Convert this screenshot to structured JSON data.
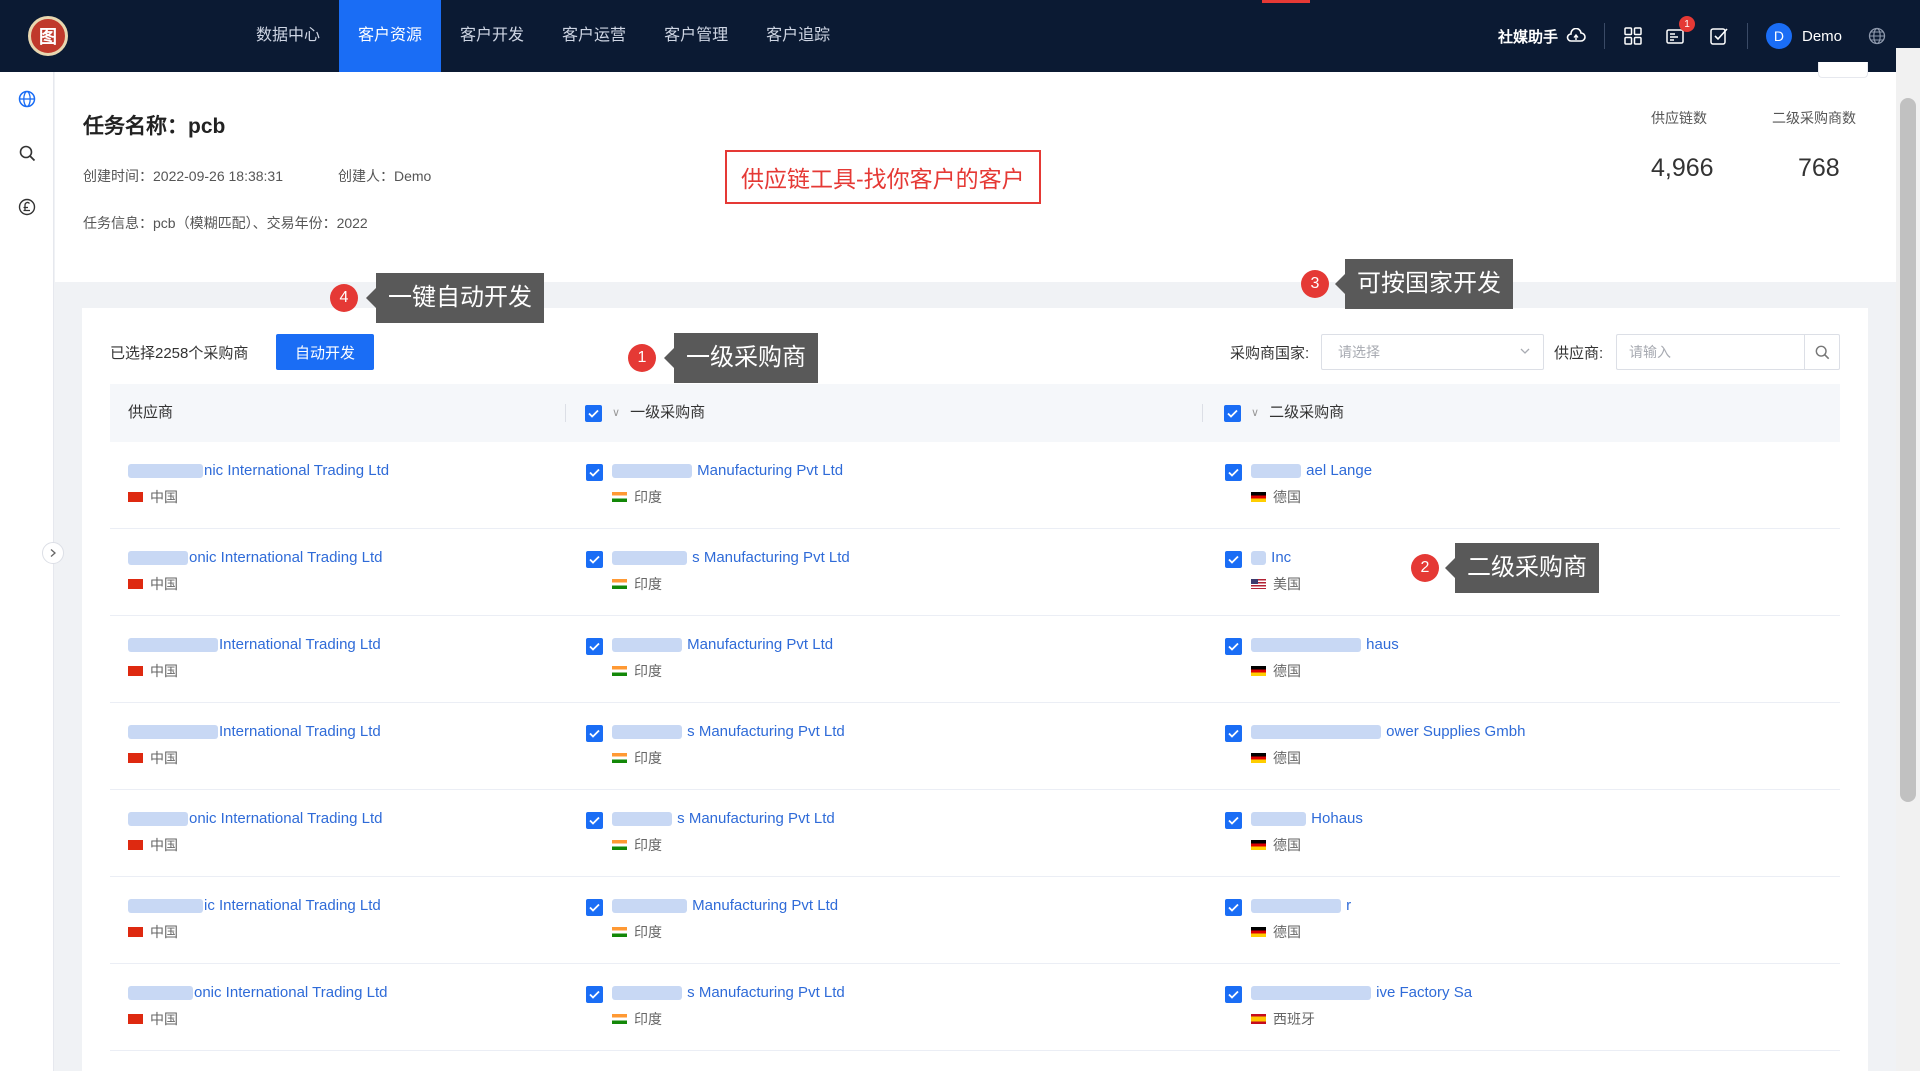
{
  "nav": {
    "logo": "图",
    "items": [
      "数据中心",
      "客户资源",
      "客户开发",
      "客户运营",
      "客户管理",
      "客户追踪"
    ],
    "active_index": 1
  },
  "topright": {
    "assistant": "社媒助手",
    "notification_count": "1",
    "user_initial": "D",
    "user_name": "Demo"
  },
  "task": {
    "title": "任务名称：pcb",
    "created_time": "创建时间：2022-09-26 18:38:31",
    "creator": "创建人：Demo",
    "info": "任务信息：pcb（模糊匹配）、交易年份：2022"
  },
  "promo_banner": "供应链工具-找你客户的客户",
  "stats": {
    "supply_chain_label": "供应链数",
    "supply_chain_value": "4,966",
    "second_buyer_label": "二级采购商数",
    "second_buyer_value": "768"
  },
  "toolbar": {
    "selected_text": "已选择2258个采购商",
    "auto_button": "自动开发",
    "country_label": "采购商国家:",
    "country_placeholder": "请选择",
    "supplier_label": "供应商:",
    "supplier_placeholder": "请输入"
  },
  "table": {
    "headers": [
      "供应商",
      "一级采购商",
      "二级采购商"
    ],
    "rows": [
      {
        "supplier": "nic International Trading Ltd",
        "supplier_country": "中国",
        "buyer1": "Manufacturing Pvt Ltd",
        "buyer1_country": "印度",
        "buyer2": "ael Lange",
        "buyer2_country": "德国",
        "buyer2_flag": "de"
      },
      {
        "supplier": "onic International Trading Ltd",
        "supplier_country": "中国",
        "buyer1": "s Manufacturing Pvt Ltd",
        "buyer1_country": "印度",
        "buyer2": "Inc",
        "buyer2_country": "美国",
        "buyer2_flag": "us"
      },
      {
        "supplier": "International Trading Ltd",
        "supplier_country": "中国",
        "buyer1": "Manufacturing Pvt Ltd",
        "buyer1_country": "印度",
        "buyer2": "haus",
        "buyer2_country": "德国",
        "buyer2_flag": "de"
      },
      {
        "supplier": "International Trading Ltd",
        "supplier_country": "中国",
        "buyer1": "s Manufacturing Pvt Ltd",
        "buyer1_country": "印度",
        "buyer2": "ower Supplies Gmbh",
        "buyer2_country": "德国",
        "buyer2_flag": "de"
      },
      {
        "supplier": "onic International Trading Ltd",
        "supplier_country": "中国",
        "buyer1": "s Manufacturing Pvt Ltd",
        "buyer1_country": "印度",
        "buyer2": "Hohaus",
        "buyer2_country": "德国",
        "buyer2_flag": "de"
      },
      {
        "supplier": "ic International Trading Ltd",
        "supplier_country": "中国",
        "buyer1": "Manufacturing Pvt Ltd",
        "buyer1_country": "印度",
        "buyer2": "r",
        "buyer2_country": "德国",
        "buyer2_flag": "de"
      },
      {
        "supplier": "onic International Trading Ltd",
        "supplier_country": "中国",
        "buyer1": "s Manufacturing Pvt Ltd",
        "buyer1_country": "印度",
        "buyer2": "ive Factory Sa",
        "buyer2_country": "西班牙",
        "buyer2_flag": "es"
      }
    ]
  },
  "annotations": {
    "n1": "1",
    "c1": "一级采购商",
    "n2": "2",
    "c2": "二级采购商",
    "n3": "3",
    "c3": "可按国家开发",
    "n4": "4",
    "c4": "一键自动开发"
  },
  "colors": {
    "nav_bg": "#0b1a33",
    "primary": "#1a6df5",
    "link": "#2f6bd8",
    "alert": "#e53935"
  }
}
